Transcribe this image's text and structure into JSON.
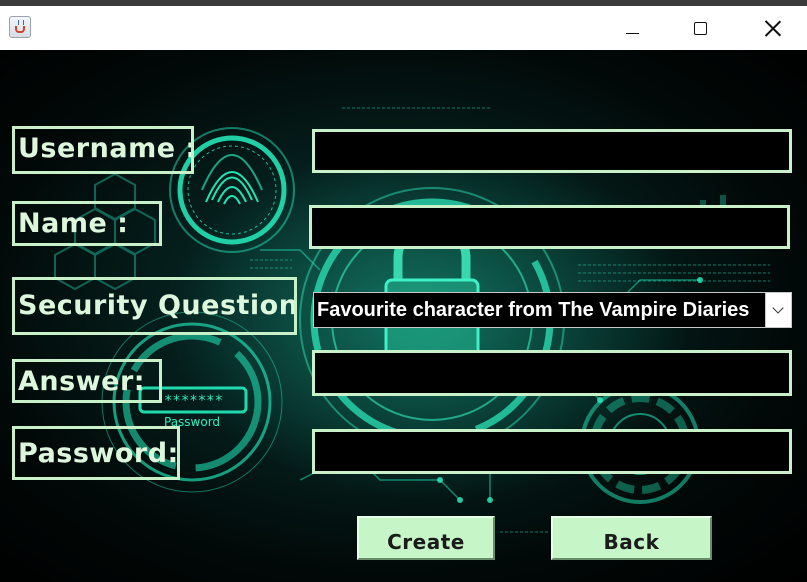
{
  "window": {
    "title": ""
  },
  "form": {
    "username_label": "Username :",
    "name_label": "Name :",
    "security_question_label": "Security Question:",
    "answer_label": "Answer:",
    "password_label": "Password:",
    "username_value": "",
    "name_value": "",
    "answer_value": "",
    "password_value": "",
    "security_question_selected": "Favourite character from The Vampire Diaries"
  },
  "buttons": {
    "create_label": "Create",
    "back_label": "Back"
  },
  "background": {
    "password_field_text": "Password",
    "password_mask": "*******"
  },
  "colors": {
    "accent": "#c8f0c9",
    "button_bg": "#c6f5c8",
    "glow": "#1fe0b4"
  }
}
